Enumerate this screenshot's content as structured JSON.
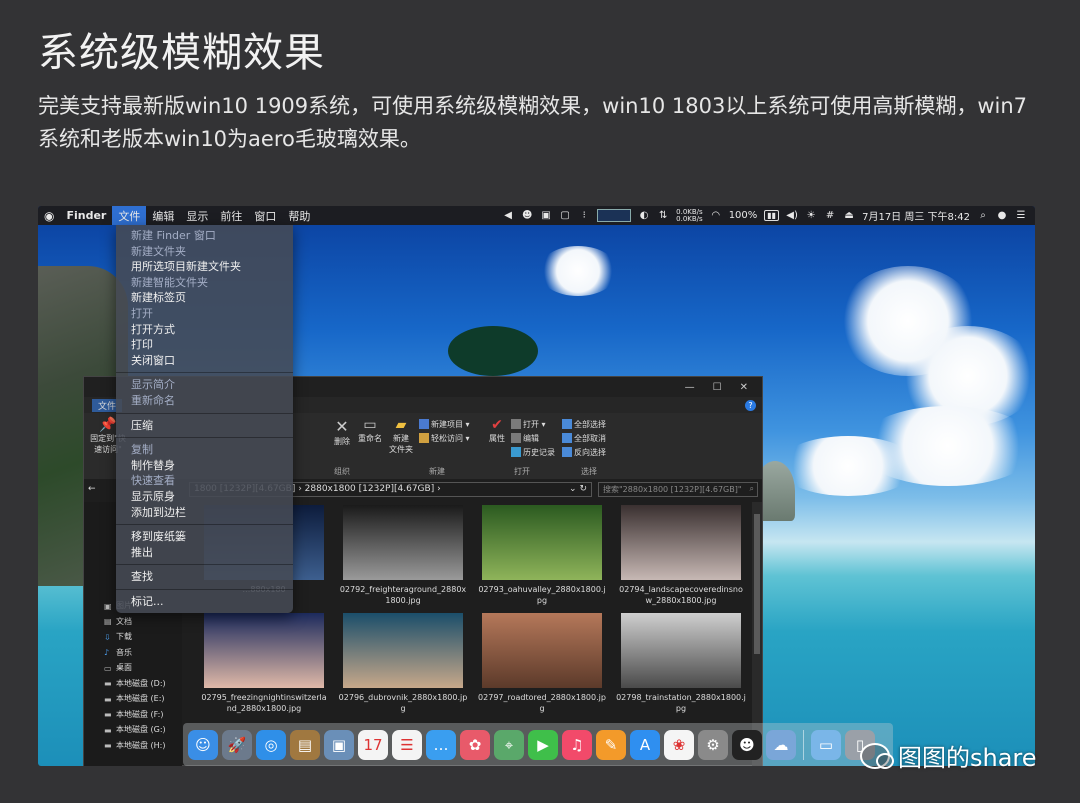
{
  "heading": "系统级模糊效果",
  "description": "完美支持最新版win10 1909系统，可使用系统级模糊效果，win10 1803以上系统可使用高斯模糊，win7系统和老版本win10为aero毛玻璃效果。",
  "menubar": {
    "apple": "",
    "items": [
      "Finder",
      "文件",
      "编辑",
      "显示",
      "前往",
      "窗口",
      "帮助"
    ],
    "active_item": "文件",
    "net_up": "0.0KB/s",
    "net_down": "0.0KB/s",
    "battery": "100%",
    "clock": "7月17日 周三 下午8:42"
  },
  "file_menu": {
    "groups": [
      [
        {
          "label": "新建 Finder 窗口",
          "disabled": true
        },
        {
          "label": "新建文件夹",
          "disabled": true
        },
        {
          "label": "用所选项目新建文件夹",
          "disabled": false
        },
        {
          "label": "新建智能文件夹",
          "disabled": true
        },
        {
          "label": "新建标签页",
          "disabled": false
        },
        {
          "label": "打开",
          "disabled": true
        },
        {
          "label": "打开方式",
          "disabled": false
        },
        {
          "label": "打印",
          "disabled": false
        },
        {
          "label": "关闭窗口",
          "disabled": false
        }
      ],
      [
        {
          "label": "显示简介",
          "disabled": true
        },
        {
          "label": "重新命名",
          "disabled": true
        }
      ],
      [
        {
          "label": "压缩",
          "disabled": false
        }
      ],
      [
        {
          "label": "复制",
          "disabled": true
        },
        {
          "label": "制作替身",
          "disabled": false
        },
        {
          "label": "快速查看",
          "disabled": true
        },
        {
          "label": "显示原身",
          "disabled": false
        },
        {
          "label": "添加到边栏",
          "disabled": false
        }
      ],
      [
        {
          "label": "移到废纸篓",
          "disabled": false
        },
        {
          "label": "推出",
          "disabled": false
        }
      ],
      [
        {
          "label": "查找",
          "disabled": false
        }
      ],
      [
        {
          "label": "标记...",
          "disabled": false
        }
      ]
    ]
  },
  "explorer": {
    "tab_file": "文件",
    "ribbon": {
      "pin_label": "固定到\"快速访问\"",
      "delete": "删除",
      "rename": "重命名",
      "new_folder": "新建\n文件夹",
      "new_item": "新建项目 ▾",
      "easy_access": "轻松访问 ▾",
      "properties": "属性",
      "open": "打开 ▾",
      "edit": "编辑",
      "history": "历史记录",
      "select_all": "全部选择",
      "select_none": "全部取消",
      "invert": "反向选择",
      "group_organize": "组织",
      "group_new": "新建",
      "group_open": "打开",
      "group_select": "选择"
    },
    "address": "1800 [1232P][4.67GB]  ›  2880x1800 [1232P][4.67GB]  ›",
    "search_placeholder": "搜索\"2880x1800 [1232P][4.67GB]\"",
    "nav_items": [
      "图片",
      "文档",
      "下载",
      "音乐",
      "桌面",
      "本地磁盘 (D:)",
      "本地磁盘 (E:)",
      "本地磁盘 (F:)",
      "本地磁盘 (G:)",
      "本地磁盘 (H:)"
    ],
    "thumbnails": [
      {
        "name": "…880x180",
        "colors": [
          "#0d1c3c",
          "#3d5f8f"
        ]
      },
      {
        "name": "02792_freighteraground_2880x1800.jpg",
        "colors": [
          "#1a1a1a",
          "#9a9a9a"
        ]
      },
      {
        "name": "02793_oahuvalley_2880x1800.jpg",
        "colors": [
          "#2b5a20",
          "#8fb45a"
        ]
      },
      {
        "name": "02794_landscapecoveredinsnow_2880x1800.jpg",
        "colors": [
          "#3a3030",
          "#c7b8b4"
        ]
      },
      {
        "name": "02795_freezingnightinswitzerland_2880x1800.jpg",
        "colors": [
          "#1c2a5c",
          "#e0b9a8"
        ]
      },
      {
        "name": "02796_dubrovnik_2880x1800.jpg",
        "colors": [
          "#1b4e6a",
          "#c7a88a"
        ]
      },
      {
        "name": "02797_roadtored_2880x1800.jpg",
        "colors": [
          "#b5785a",
          "#5c3a2a"
        ]
      },
      {
        "name": "02798_trainstation_2880x1800.jpg",
        "colors": [
          "#cfcfcf",
          "#4a4a4a"
        ]
      }
    ]
  },
  "dock": {
    "items": [
      {
        "name": "finder-icon",
        "glyph": "☺",
        "color": "#3a8ee6"
      },
      {
        "name": "launchpad-icon",
        "glyph": "🚀",
        "color": "#6c7a8c"
      },
      {
        "name": "safari-icon",
        "glyph": "◎",
        "color": "#2f8fe8"
      },
      {
        "name": "notes-book-icon",
        "glyph": "▤",
        "color": "#a07840"
      },
      {
        "name": "preview-icon",
        "glyph": "▣",
        "color": "#6a8fb8"
      },
      {
        "name": "calendar-icon",
        "glyph": "17",
        "color": "#f4f4f4"
      },
      {
        "name": "reminders-icon",
        "glyph": "☰",
        "color": "#f4f4f4"
      },
      {
        "name": "messages-icon",
        "glyph": "…",
        "color": "#3a9ef0"
      },
      {
        "name": "photos-color-icon",
        "glyph": "✿",
        "color": "#e85a6a"
      },
      {
        "name": "maps-icon",
        "glyph": "⌖",
        "color": "#5aa86a"
      },
      {
        "name": "facetime-icon",
        "glyph": "▶",
        "color": "#3fbf4a"
      },
      {
        "name": "music-icon",
        "glyph": "♫",
        "color": "#f24a6a"
      },
      {
        "name": "books-icon",
        "glyph": "✎",
        "color": "#f39a2a"
      },
      {
        "name": "app-store-icon",
        "glyph": "A",
        "color": "#2f8ff0"
      },
      {
        "name": "photos-icon",
        "glyph": "❀",
        "color": "#f5f5f5"
      },
      {
        "name": "system-preferences-icon",
        "glyph": "⚙",
        "color": "#8a8a8a"
      },
      {
        "name": "qq-icon",
        "glyph": "☻",
        "color": "#222222"
      },
      {
        "name": "weather-icon",
        "glyph": "☁",
        "color": "#7aa6d8"
      },
      {
        "name": "folder-icon",
        "glyph": "▭",
        "color": "#7ab6e8"
      },
      {
        "name": "trash-icon",
        "glyph": "▯",
        "color": "#9aa0a8"
      }
    ]
  },
  "watermark": "图图的share"
}
